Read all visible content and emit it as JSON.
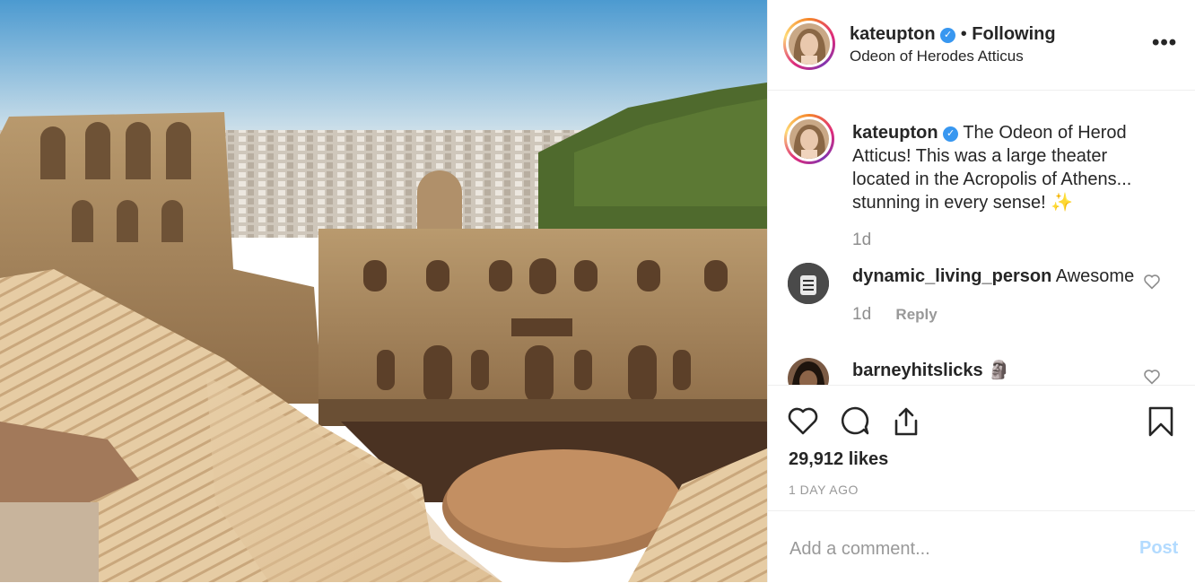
{
  "post": {
    "username": "kateupton",
    "follow_status": "Following",
    "separator": "•",
    "location": "Odeon of Herodes Atticus",
    "more_label": "•••"
  },
  "caption": {
    "username": "kateupton",
    "text": "The Odeon of Herod Atticus! This was a large theater located in the Acropolis of Athens... stunning in every sense! ✨",
    "time": "1d"
  },
  "comments": [
    {
      "username": "dynamic_living_person",
      "text": "Awesome",
      "time": "1d",
      "reply_label": "Reply"
    },
    {
      "username": "barneyhitslicks",
      "text": "🗿",
      "time": "",
      "reply_label": ""
    }
  ],
  "actions": {
    "icons": [
      "heart-icon",
      "comment-icon",
      "share-icon",
      "bookmark-icon"
    ],
    "likes": "29,912 likes",
    "posted_ago": "1 DAY AGO"
  },
  "add_comment": {
    "placeholder": "Add a comment...",
    "post_label": "Post"
  },
  "colors": {
    "verified": "#3897f0",
    "post_disabled": "#b3dbff",
    "muted": "#8e8e8e",
    "text": "#262626"
  }
}
